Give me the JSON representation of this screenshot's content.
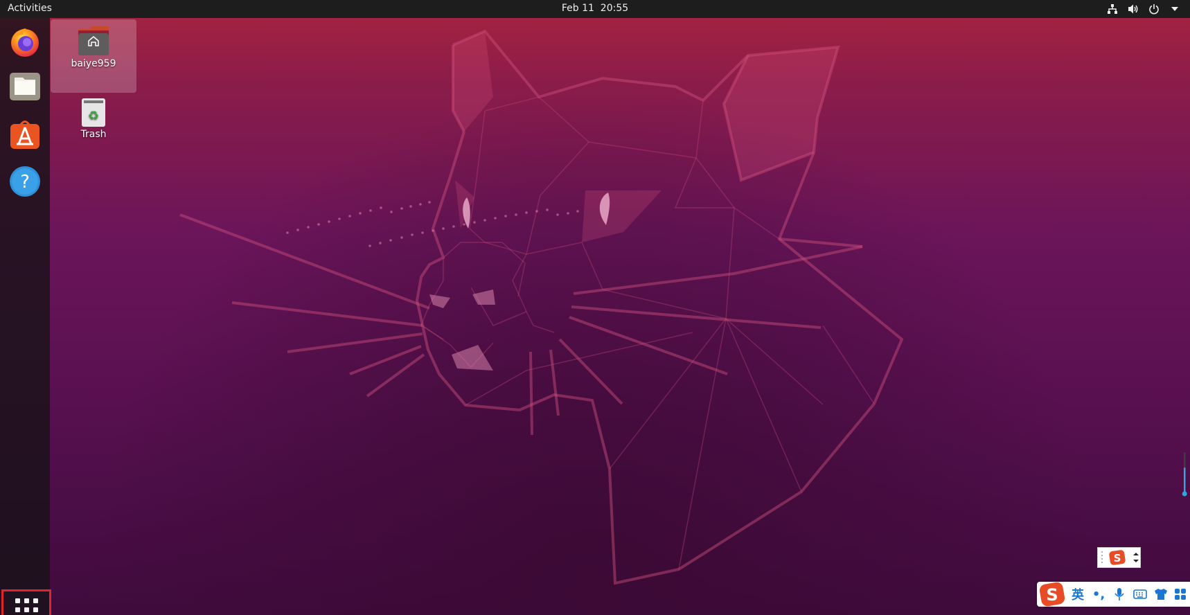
{
  "topbar": {
    "activities_label": "Activities",
    "date": "Feb 11",
    "time": "20:55",
    "tray_icons": [
      "network-icon",
      "volume-icon",
      "power-icon",
      "chevron-down-icon"
    ]
  },
  "dock": {
    "items": [
      {
        "name": "firefox-icon"
      },
      {
        "name": "files-icon"
      },
      {
        "name": "software-icon"
      },
      {
        "name": "help-icon"
      }
    ],
    "show_apps_icon": "grid-icon"
  },
  "desktop": {
    "icons": [
      {
        "label": "baiye959",
        "icon": "home-folder-icon"
      },
      {
        "label": "Trash",
        "icon": "trash-icon"
      }
    ]
  },
  "ime": {
    "lang_label": "英",
    "punct_label": "•,",
    "toolbar_icons": [
      "sogou-logo-icon",
      "microphone-icon",
      "keyboard-icon",
      "shirt-icon",
      "grid-icon"
    ]
  },
  "colors": {
    "topbar": "#1d1d1d",
    "accent_red": "#e0242b",
    "wallpaper_top": "#a8233f",
    "wallpaper_bottom": "#3e0b3c"
  }
}
